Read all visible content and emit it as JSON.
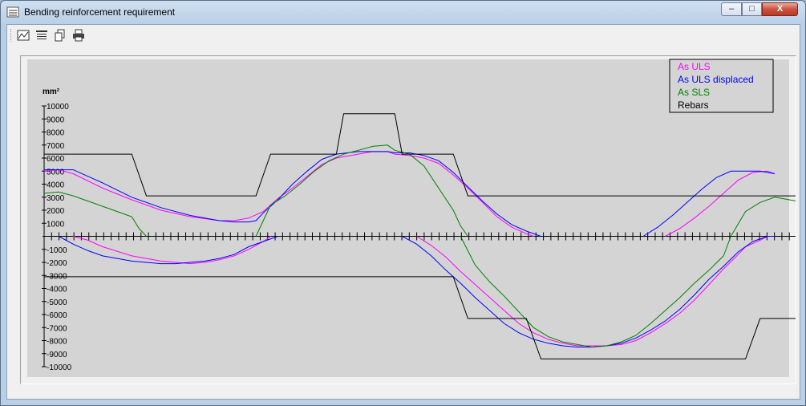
{
  "window": {
    "title": "Bending reinforcement requirement",
    "controls": {
      "minimize": "–",
      "maximize": "□",
      "close": "X"
    }
  },
  "toolbar": {
    "items": [
      {
        "icon": "chart-icon"
      },
      {
        "icon": "list-lines-icon"
      },
      {
        "icon": "copy-icon"
      },
      {
        "icon": "print-icon"
      }
    ]
  },
  "colors": {
    "as_uls": "#ff00ff",
    "as_uls_displaced": "#0000ff",
    "as_sls": "#008000",
    "rebars": "#000000",
    "plot_bg": "#d4d4d4"
  },
  "chart_data": {
    "type": "line",
    "ylabel": "mm²",
    "ylim": [
      -10000,
      10000
    ],
    "yticks": [
      10000,
      9000,
      8000,
      7000,
      6000,
      5000,
      4000,
      3000,
      2000,
      1000,
      -1000,
      -2000,
      -3000,
      -4000,
      -5000,
      -6000,
      -7000,
      -8000,
      -9000,
      -10000
    ],
    "xlim": [
      0,
      100
    ],
    "x_tick_count": 101,
    "grid": false,
    "legend": "top-right",
    "series": [
      {
        "name": "As ULS",
        "color": "#ff00ff",
        "segments": [
          [
            [
              0,
              5000
            ],
            [
              2,
              5100
            ],
            [
              4,
              4800
            ],
            [
              8,
              3700
            ],
            [
              12,
              2800
            ],
            [
              16,
              2000
            ],
            [
              20,
              1500
            ],
            [
              24,
              1200
            ],
            [
              26,
              1200
            ],
            [
              28,
              1400
            ],
            [
              30,
              1900
            ],
            [
              32,
              2900
            ],
            [
              34,
              3700
            ],
            [
              36,
              4600
            ],
            [
              38,
              5500
            ],
            [
              40,
              6000
            ],
            [
              43,
              6300
            ],
            [
              45,
              6500
            ],
            [
              47,
              6500
            ],
            [
              48,
              6300
            ],
            [
              50,
              6200
            ],
            [
              52,
              6000
            ],
            [
              54,
              5600
            ],
            [
              56,
              4700
            ],
            [
              58,
              3700
            ],
            [
              60,
              2600
            ],
            [
              62,
              1500
            ],
            [
              64,
              700
            ],
            [
              66,
              200
            ],
            [
              67,
              0
            ]
          ],
          [
            [
              4,
              0
            ],
            [
              6,
              -300
            ],
            [
              8,
              -800
            ],
            [
              12,
              -1500
            ],
            [
              16,
              -1900
            ],
            [
              18,
              -2000
            ],
            [
              20,
              -2100
            ],
            [
              22,
              -2000
            ],
            [
              24,
              -1800
            ],
            [
              26,
              -1500
            ],
            [
              28,
              -1000
            ],
            [
              30,
              -400
            ],
            [
              31,
              0
            ]
          ],
          [
            [
              51,
              0
            ],
            [
              53,
              -700
            ],
            [
              55,
              -1600
            ],
            [
              57,
              -2700
            ],
            [
              59,
              -3700
            ],
            [
              61,
              -4700
            ],
            [
              63,
              -5700
            ],
            [
              65,
              -6700
            ],
            [
              67,
              -7400
            ],
            [
              69,
              -7900
            ],
            [
              71,
              -8200
            ],
            [
              73,
              -8400
            ],
            [
              75,
              -8400
            ],
            [
              77,
              -8400
            ],
            [
              79,
              -8300
            ],
            [
              81,
              -8000
            ],
            [
              83,
              -7400
            ],
            [
              85,
              -6700
            ],
            [
              87,
              -5900
            ],
            [
              89,
              -4900
            ],
            [
              91,
              -3700
            ],
            [
              93,
              -2500
            ],
            [
              95,
              -1400
            ],
            [
              96,
              -800
            ],
            [
              98,
              -300
            ],
            [
              99,
              0
            ]
          ],
          [
            [
              85,
              0
            ],
            [
              87,
              600
            ],
            [
              89,
              1400
            ],
            [
              91,
              2300
            ],
            [
              93,
              3300
            ],
            [
              95,
              4300
            ],
            [
              97,
              4900
            ],
            [
              99,
              5000
            ],
            [
              100,
              4800
            ]
          ]
        ]
      },
      {
        "name": "As ULS displaced",
        "color": "#0000ff",
        "segments": [
          [
            [
              0,
              5100
            ],
            [
              2,
              5100
            ],
            [
              4,
              5100
            ],
            [
              6,
              4600
            ],
            [
              8,
              4100
            ],
            [
              12,
              3000
            ],
            [
              16,
              2200
            ],
            [
              20,
              1600
            ],
            [
              24,
              1200
            ],
            [
              26,
              1100
            ],
            [
              28,
              1100
            ],
            [
              29,
              1200
            ],
            [
              30,
              1800
            ],
            [
              32,
              2800
            ],
            [
              34,
              4000
            ],
            [
              36,
              5000
            ],
            [
              38,
              5900
            ],
            [
              40,
              6300
            ],
            [
              43,
              6500
            ],
            [
              45,
              6500
            ],
            [
              47,
              6500
            ],
            [
              48,
              6400
            ],
            [
              50,
              6400
            ],
            [
              52,
              6200
            ],
            [
              54,
              5800
            ],
            [
              56,
              4900
            ],
            [
              58,
              3800
            ],
            [
              60,
              2700
            ],
            [
              62,
              1700
            ],
            [
              64,
              900
            ],
            [
              66,
              400
            ],
            [
              68,
              0
            ]
          ],
          [
            [
              2,
              0
            ],
            [
              4,
              -600
            ],
            [
              6,
              -1100
            ],
            [
              8,
              -1500
            ],
            [
              10,
              -1700
            ],
            [
              12,
              -1900
            ],
            [
              14,
              -2000
            ],
            [
              16,
              -2100
            ],
            [
              18,
              -2100
            ],
            [
              20,
              -2000
            ],
            [
              22,
              -1900
            ],
            [
              24,
              -1700
            ],
            [
              26,
              -1400
            ],
            [
              28,
              -800
            ],
            [
              30,
              -400
            ],
            [
              32,
              0
            ]
          ],
          [
            [
              49,
              0
            ],
            [
              51,
              -600
            ],
            [
              53,
              -1500
            ],
            [
              55,
              -2600
            ],
            [
              57,
              -3600
            ],
            [
              59,
              -4700
            ],
            [
              61,
              -5700
            ],
            [
              63,
              -6700
            ],
            [
              65,
              -7400
            ],
            [
              67,
              -7900
            ],
            [
              69,
              -8200
            ],
            [
              71,
              -8400
            ],
            [
              73,
              -8500
            ],
            [
              75,
              -8500
            ],
            [
              77,
              -8400
            ],
            [
              79,
              -8200
            ],
            [
              81,
              -7800
            ],
            [
              83,
              -7200
            ],
            [
              85,
              -6500
            ],
            [
              87,
              -5600
            ],
            [
              89,
              -4500
            ],
            [
              91,
              -3300
            ],
            [
              93,
              -2300
            ],
            [
              95,
              -1200
            ],
            [
              97,
              -400
            ],
            [
              99,
              0
            ],
            [
              100,
              0
            ]
          ],
          [
            [
              82,
              0
            ],
            [
              84,
              700
            ],
            [
              86,
              1600
            ],
            [
              88,
              2600
            ],
            [
              90,
              3600
            ],
            [
              92,
              4500
            ],
            [
              94,
              5000
            ],
            [
              96,
              5000
            ],
            [
              98,
              5000
            ],
            [
              100,
              4800
            ]
          ]
        ]
      },
      {
        "name": "As SLS",
        "color": "#008000",
        "segments": [
          [
            [
              0,
              3300
            ],
            [
              2,
              3400
            ],
            [
              4,
              3100
            ],
            [
              6,
              2700
            ],
            [
              8,
              2300
            ],
            [
              10,
              1900
            ],
            [
              12,
              1500
            ],
            [
              13,
              600
            ],
            [
              14,
              0
            ]
          ],
          [
            [
              29,
              0
            ],
            [
              31,
              2400
            ],
            [
              33,
              3100
            ],
            [
              35,
              4000
            ],
            [
              37,
              5000
            ],
            [
              39,
              5800
            ],
            [
              41,
              6300
            ],
            [
              43,
              6600
            ],
            [
              45,
              6900
            ],
            [
              47,
              7000
            ],
            [
              48,
              6600
            ],
            [
              50,
              6300
            ],
            [
              52,
              5400
            ],
            [
              54,
              3700
            ],
            [
              56,
              2000
            ],
            [
              57,
              800
            ],
            [
              58,
              0
            ]
          ],
          [
            [
              57,
              0
            ],
            [
              59,
              -2200
            ],
            [
              61,
              -3500
            ],
            [
              63,
              -4600
            ],
            [
              65,
              -5800
            ],
            [
              67,
              -7000
            ],
            [
              69,
              -7700
            ],
            [
              71,
              -8100
            ],
            [
              73,
              -8300
            ],
            [
              75,
              -8500
            ],
            [
              77,
              -8400
            ],
            [
              79,
              -8100
            ],
            [
              81,
              -7600
            ],
            [
              83,
              -6700
            ],
            [
              85,
              -5700
            ],
            [
              87,
              -4700
            ],
            [
              89,
              -3600
            ],
            [
              91,
              -2600
            ],
            [
              93,
              -1500
            ],
            [
              94,
              0
            ]
          ],
          [
            [
              94,
              0
            ],
            [
              96,
              1900
            ],
            [
              98,
              2600
            ],
            [
              100,
              3000
            ],
            [
              101,
              2900
            ],
            [
              103,
              2700
            ]
          ]
        ]
      },
      {
        "name": "Rebars",
        "color": "#000000",
        "segments": [
          [
            [
              0,
              6300
            ],
            [
              12,
              6300
            ],
            [
              14,
              3100
            ],
            [
              29,
              3100
            ],
            [
              31,
              6300
            ],
            [
              40,
              6300
            ],
            [
              41,
              9400
            ],
            [
              48,
              9400
            ],
            [
              49,
              6300
            ],
            [
              56,
              6300
            ],
            [
              58,
              3100
            ],
            [
              104,
              3100
            ],
            [
              106,
              6300
            ],
            [
              113,
              6300
            ],
            [
              113,
              0
            ]
          ],
          [
            [
              0,
              -3100
            ],
            [
              56,
              -3100
            ],
            [
              58,
              -6300
            ],
            [
              66,
              -6300
            ],
            [
              68,
              -9400
            ],
            [
              96,
              -9400
            ],
            [
              98,
              -6300
            ],
            [
              105,
              -6300
            ],
            [
              107,
              -3100
            ],
            [
              113,
              -3100
            ],
            [
              113,
              0
            ]
          ]
        ]
      }
    ]
  }
}
